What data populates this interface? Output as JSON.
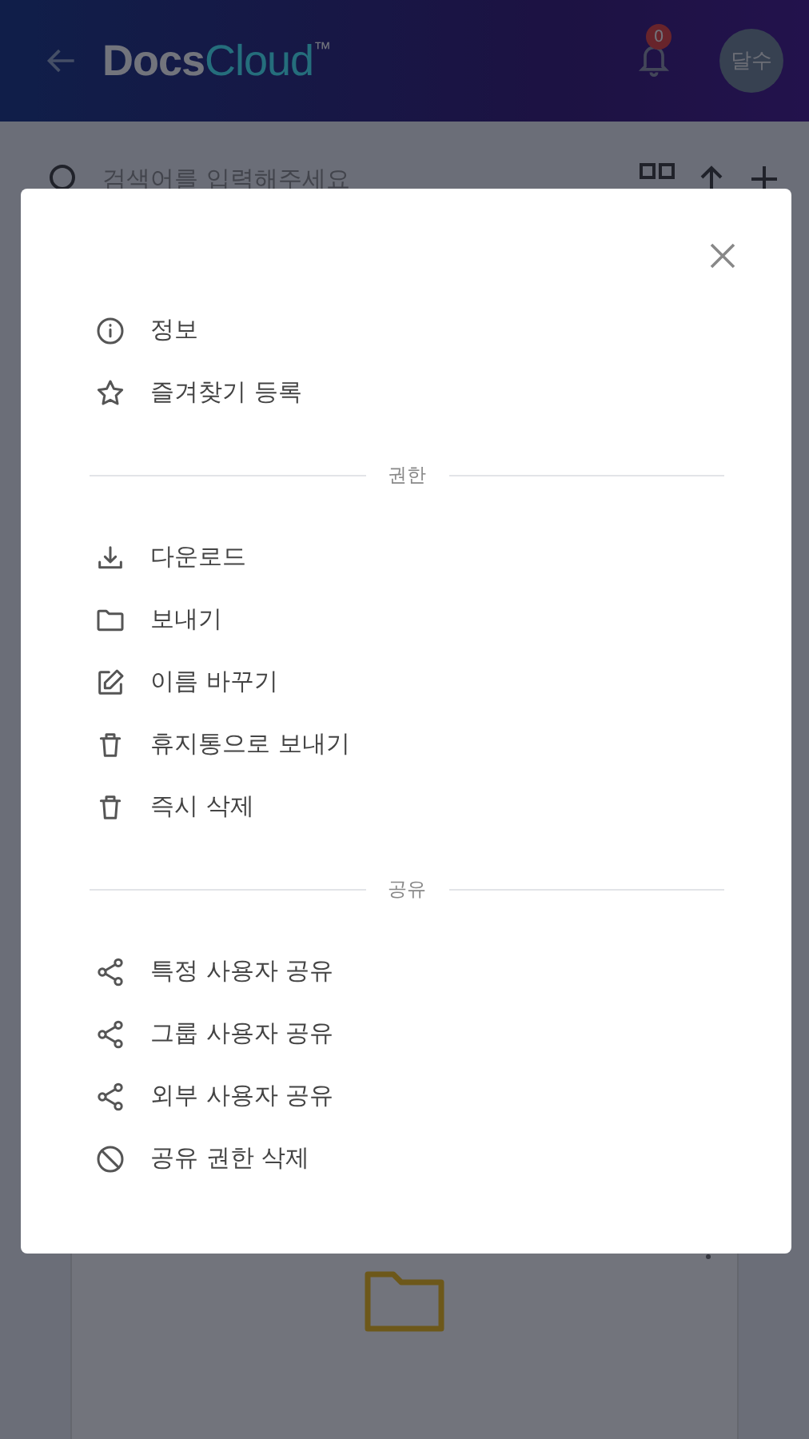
{
  "header": {
    "logo": {
      "primary": "Docs",
      "secondary": "Cloud",
      "mark": "™"
    },
    "notification_count": "0",
    "avatar": "달수"
  },
  "search": {
    "placeholder": "검색어를 입력해주세요"
  },
  "menu": {
    "sections": [
      {
        "items": [
          {
            "label": "정보",
            "kind": "info"
          },
          {
            "label": "즐겨찾기 등록",
            "kind": "star"
          }
        ]
      },
      {
        "heading": "권한",
        "items": [
          {
            "label": "다운로드",
            "kind": "download"
          },
          {
            "label": "보내기",
            "kind": "folder"
          },
          {
            "label": "이름 바꾸기",
            "kind": "edit"
          },
          {
            "label": "휴지통으로 보내기",
            "kind": "trash"
          },
          {
            "label": "즉시 삭제",
            "kind": "trash"
          }
        ]
      },
      {
        "heading": "공유",
        "items": [
          {
            "label": "특정 사용자 공유",
            "kind": "share"
          },
          {
            "label": "그룹 사용자 공유",
            "kind": "share"
          },
          {
            "label": "외부 사용자 공유",
            "kind": "share"
          },
          {
            "label": "공유 권한 삭제",
            "kind": "block"
          }
        ]
      }
    ]
  }
}
